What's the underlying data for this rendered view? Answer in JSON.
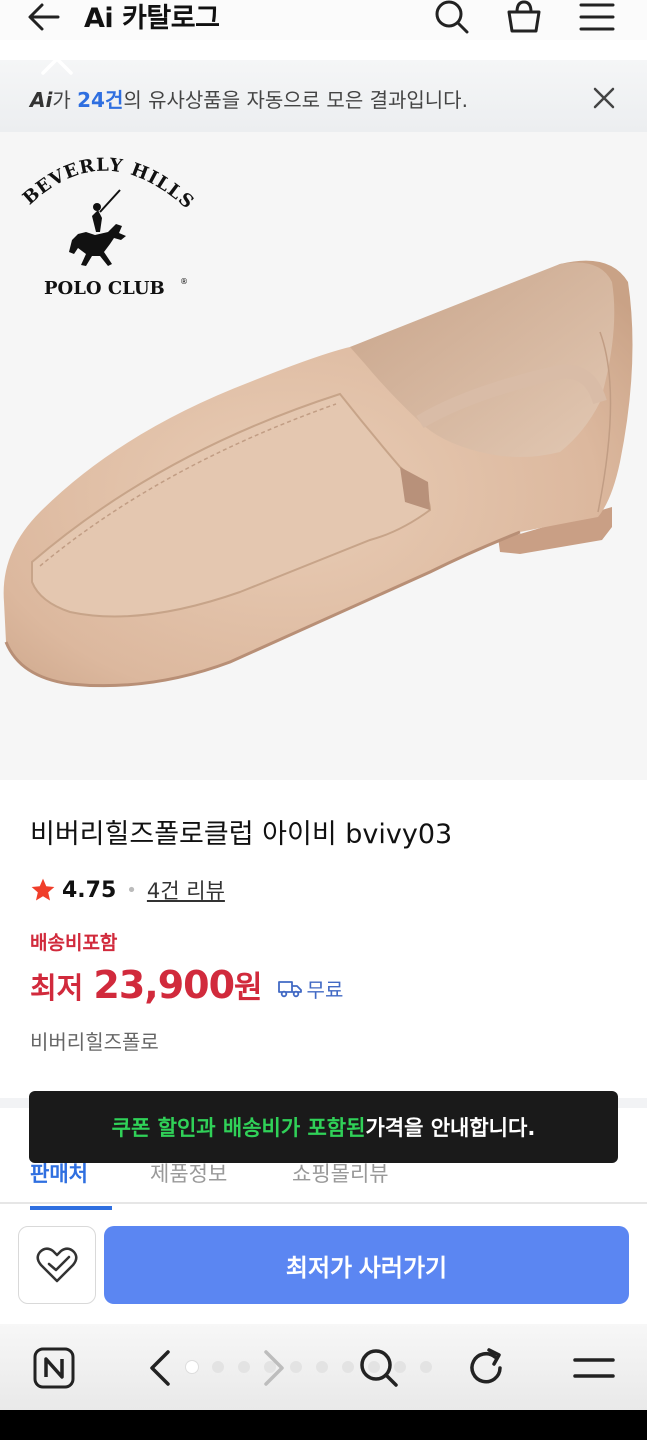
{
  "header": {
    "title": "Ai 카탈로그",
    "icons": [
      "back-arrow-icon",
      "search-icon",
      "cart-icon",
      "menu-icon"
    ]
  },
  "ai_notice": {
    "ai_label": "Ai",
    "text_before": "가 ",
    "count": "24건",
    "text_after": "의 유사상품을 자동으로 모은 결과입니다."
  },
  "product_image": {
    "brand_arc": "BEVERLY HILLS",
    "brand_bottom": "POLO CLUB",
    "brand_mark": "®"
  },
  "product": {
    "name": "비버리힐즈폴로클럽 아이비 bvivy03",
    "rating": "4.75",
    "review_link": "4건 리뷰",
    "shipping_label": "배송비포함",
    "price_prefix": "최저",
    "price": "23,900",
    "price_unit": "원",
    "shipping_free": "무료",
    "seller": "비버리힐즈폴로"
  },
  "tabs": [
    "판매처",
    "제품정보",
    "쇼핑몰리뷰"
  ],
  "toast": {
    "highlight": "쿠폰 할인과 배송비가 포함된",
    "rest": " 가격을 안내합니다."
  },
  "actions": {
    "buy_label": "최저가 사러가기"
  },
  "colors": {
    "accent_blue": "#5b86f2",
    "price_red": "#d12a3c",
    "toast_green": "#30d158"
  }
}
